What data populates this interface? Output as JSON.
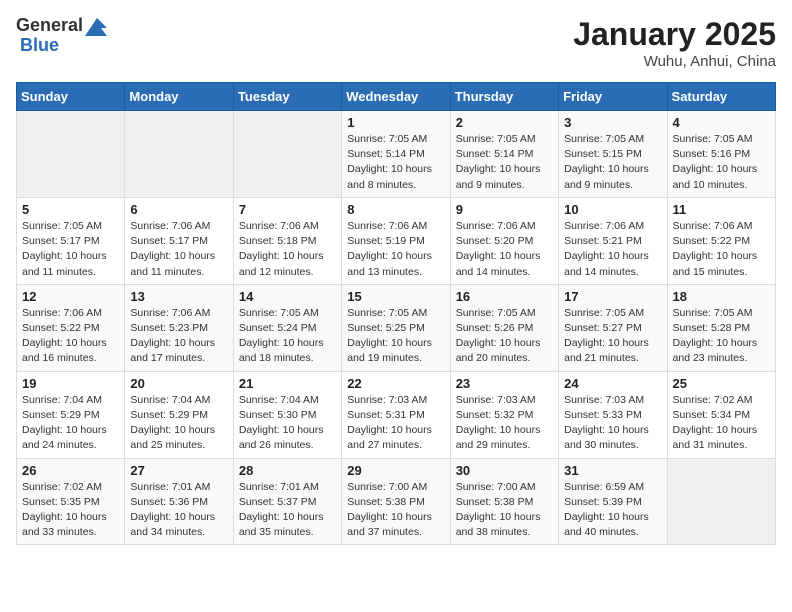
{
  "logo": {
    "general": "General",
    "blue": "Blue"
  },
  "header": {
    "month": "January 2025",
    "location": "Wuhu, Anhui, China"
  },
  "weekdays": [
    "Sunday",
    "Monday",
    "Tuesday",
    "Wednesday",
    "Thursday",
    "Friday",
    "Saturday"
  ],
  "weeks": [
    [
      {
        "day": "",
        "info": ""
      },
      {
        "day": "",
        "info": ""
      },
      {
        "day": "",
        "info": ""
      },
      {
        "day": "1",
        "info": "Sunrise: 7:05 AM\nSunset: 5:14 PM\nDaylight: 10 hours\nand 8 minutes."
      },
      {
        "day": "2",
        "info": "Sunrise: 7:05 AM\nSunset: 5:14 PM\nDaylight: 10 hours\nand 9 minutes."
      },
      {
        "day": "3",
        "info": "Sunrise: 7:05 AM\nSunset: 5:15 PM\nDaylight: 10 hours\nand 9 minutes."
      },
      {
        "day": "4",
        "info": "Sunrise: 7:05 AM\nSunset: 5:16 PM\nDaylight: 10 hours\nand 10 minutes."
      }
    ],
    [
      {
        "day": "5",
        "info": "Sunrise: 7:05 AM\nSunset: 5:17 PM\nDaylight: 10 hours\nand 11 minutes."
      },
      {
        "day": "6",
        "info": "Sunrise: 7:06 AM\nSunset: 5:17 PM\nDaylight: 10 hours\nand 11 minutes."
      },
      {
        "day": "7",
        "info": "Sunrise: 7:06 AM\nSunset: 5:18 PM\nDaylight: 10 hours\nand 12 minutes."
      },
      {
        "day": "8",
        "info": "Sunrise: 7:06 AM\nSunset: 5:19 PM\nDaylight: 10 hours\nand 13 minutes."
      },
      {
        "day": "9",
        "info": "Sunrise: 7:06 AM\nSunset: 5:20 PM\nDaylight: 10 hours\nand 14 minutes."
      },
      {
        "day": "10",
        "info": "Sunrise: 7:06 AM\nSunset: 5:21 PM\nDaylight: 10 hours\nand 14 minutes."
      },
      {
        "day": "11",
        "info": "Sunrise: 7:06 AM\nSunset: 5:22 PM\nDaylight: 10 hours\nand 15 minutes."
      }
    ],
    [
      {
        "day": "12",
        "info": "Sunrise: 7:06 AM\nSunset: 5:22 PM\nDaylight: 10 hours\nand 16 minutes."
      },
      {
        "day": "13",
        "info": "Sunrise: 7:06 AM\nSunset: 5:23 PM\nDaylight: 10 hours\nand 17 minutes."
      },
      {
        "day": "14",
        "info": "Sunrise: 7:05 AM\nSunset: 5:24 PM\nDaylight: 10 hours\nand 18 minutes."
      },
      {
        "day": "15",
        "info": "Sunrise: 7:05 AM\nSunset: 5:25 PM\nDaylight: 10 hours\nand 19 minutes."
      },
      {
        "day": "16",
        "info": "Sunrise: 7:05 AM\nSunset: 5:26 PM\nDaylight: 10 hours\nand 20 minutes."
      },
      {
        "day": "17",
        "info": "Sunrise: 7:05 AM\nSunset: 5:27 PM\nDaylight: 10 hours\nand 21 minutes."
      },
      {
        "day": "18",
        "info": "Sunrise: 7:05 AM\nSunset: 5:28 PM\nDaylight: 10 hours\nand 23 minutes."
      }
    ],
    [
      {
        "day": "19",
        "info": "Sunrise: 7:04 AM\nSunset: 5:29 PM\nDaylight: 10 hours\nand 24 minutes."
      },
      {
        "day": "20",
        "info": "Sunrise: 7:04 AM\nSunset: 5:29 PM\nDaylight: 10 hours\nand 25 minutes."
      },
      {
        "day": "21",
        "info": "Sunrise: 7:04 AM\nSunset: 5:30 PM\nDaylight: 10 hours\nand 26 minutes."
      },
      {
        "day": "22",
        "info": "Sunrise: 7:03 AM\nSunset: 5:31 PM\nDaylight: 10 hours\nand 27 minutes."
      },
      {
        "day": "23",
        "info": "Sunrise: 7:03 AM\nSunset: 5:32 PM\nDaylight: 10 hours\nand 29 minutes."
      },
      {
        "day": "24",
        "info": "Sunrise: 7:03 AM\nSunset: 5:33 PM\nDaylight: 10 hours\nand 30 minutes."
      },
      {
        "day": "25",
        "info": "Sunrise: 7:02 AM\nSunset: 5:34 PM\nDaylight: 10 hours\nand 31 minutes."
      }
    ],
    [
      {
        "day": "26",
        "info": "Sunrise: 7:02 AM\nSunset: 5:35 PM\nDaylight: 10 hours\nand 33 minutes."
      },
      {
        "day": "27",
        "info": "Sunrise: 7:01 AM\nSunset: 5:36 PM\nDaylight: 10 hours\nand 34 minutes."
      },
      {
        "day": "28",
        "info": "Sunrise: 7:01 AM\nSunset: 5:37 PM\nDaylight: 10 hours\nand 35 minutes."
      },
      {
        "day": "29",
        "info": "Sunrise: 7:00 AM\nSunset: 5:38 PM\nDaylight: 10 hours\nand 37 minutes."
      },
      {
        "day": "30",
        "info": "Sunrise: 7:00 AM\nSunset: 5:38 PM\nDaylight: 10 hours\nand 38 minutes."
      },
      {
        "day": "31",
        "info": "Sunrise: 6:59 AM\nSunset: 5:39 PM\nDaylight: 10 hours\nand 40 minutes."
      },
      {
        "day": "",
        "info": ""
      }
    ]
  ]
}
